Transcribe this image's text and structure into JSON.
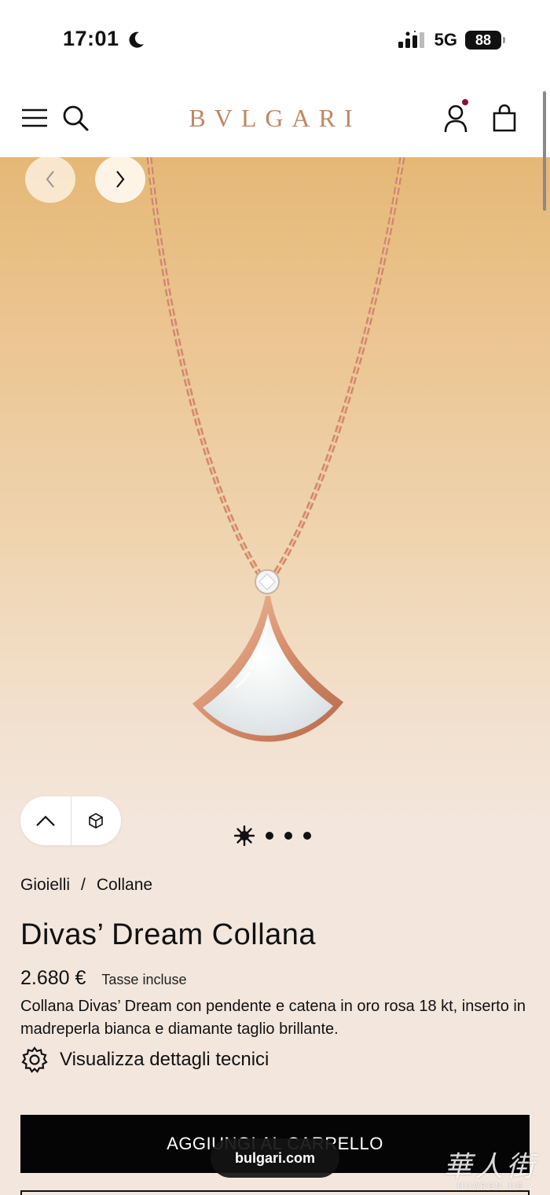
{
  "status_bar": {
    "time": "17:01",
    "network": "5G",
    "battery": "88",
    "icons": [
      "moon-icon",
      "signal-icon"
    ]
  },
  "header": {
    "logo": "BVLGARI",
    "icons": [
      "menu-icon",
      "search-icon",
      "account-icon",
      "bag-icon"
    ],
    "notification_color": "#8a1042",
    "logo_color": "#c18660"
  },
  "gallery": {
    "prev_icon": "chevron-left-icon",
    "next_icon": "chevron-right-icon",
    "pager_count": 4,
    "active_index": 0
  },
  "breadcrumb": {
    "items": [
      "Gioielli",
      "Collane"
    ],
    "separator": "/"
  },
  "product": {
    "title": "Divas’ Dream Collana",
    "price": "2.680 €",
    "tax_note": "Tasse incluse",
    "description": "Collana Divas’ Dream con pendente e catena in oro rosa 18 kt, inserto in madreperla bianca e diamante taglio brillante.",
    "tech_details_label": "Visualizza dettagli tecnici"
  },
  "cta": {
    "add_to_cart_label": "AGGIUNGI AL CARRELLO"
  },
  "browser": {
    "url": "bulgari.com"
  },
  "watermark": {
    "glyphs": "華人街",
    "text": "HUAREN.JIE"
  }
}
